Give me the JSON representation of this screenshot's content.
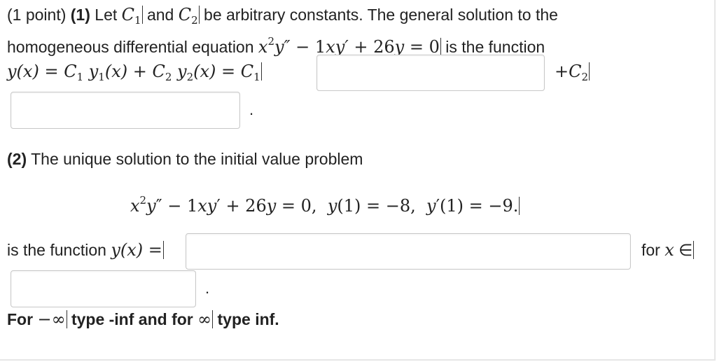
{
  "problem": {
    "points": "(1 point)",
    "part1_num": "(1)",
    "line1_let": " Let ",
    "c1": "C",
    "c2": "C",
    "sub1": "1",
    "sub2": "2",
    "line1_and": " and ",
    "line1_rest": " be arbitrary constants. The general solution to the",
    "line2_text": "homogeneous differential equation ",
    "line2_end": " is the function",
    "de_coef_a": "1",
    "de_coef_b": "26",
    "line3_lhs": "y(x) = ",
    "plus_c2": "+C",
    "part2_num": "(2)",
    "part2_text": " The unique solution to the initial value problem",
    "ivp_y1": "−8",
    "ivp_yp1": "−9.",
    "is_func_text": "is the function ",
    "for_x_text": "for ",
    "element_of": " ∈",
    "footer_for": "For ",
    "footer_minus_inf": "−∞",
    "footer_type_neg": " type -inf and for ",
    "footer_inf": "∞",
    "footer_type_pos": " type inf.",
    "period": "."
  }
}
